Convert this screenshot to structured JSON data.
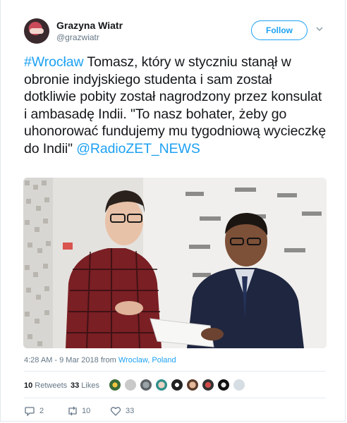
{
  "user": {
    "display_name": "Grazyna Wiatr",
    "handle": "@grazwiatr"
  },
  "follow_button": {
    "label": "Follow"
  },
  "tweet": {
    "hashtag": "#Wrocław",
    "body": " Tomasz, który w styczniu stanął w obronie indyjskiego studenta i sam został dotkliwie pobity został nagrodzony przez konsulat i ambasadę Indii. \"To nasz bohater, żeby go uhonorować fundujemy mu tygodniową wycieczkę do Indii\" ",
    "mention": "@RadioZET_NEWS"
  },
  "meta": {
    "time": "4:28 AM - 9 Mar 2018 from ",
    "place": "Wroclaw, Poland"
  },
  "stats": {
    "retweets_count": "10",
    "retweets_label": " Retweets",
    "likes_count": "33",
    "likes_label": " Likes"
  },
  "actions": {
    "replies": "2",
    "retweets": "10",
    "likes": "33"
  },
  "colors": {
    "link": "#1da1f2",
    "text": "#14171a",
    "muted": "#657786"
  }
}
